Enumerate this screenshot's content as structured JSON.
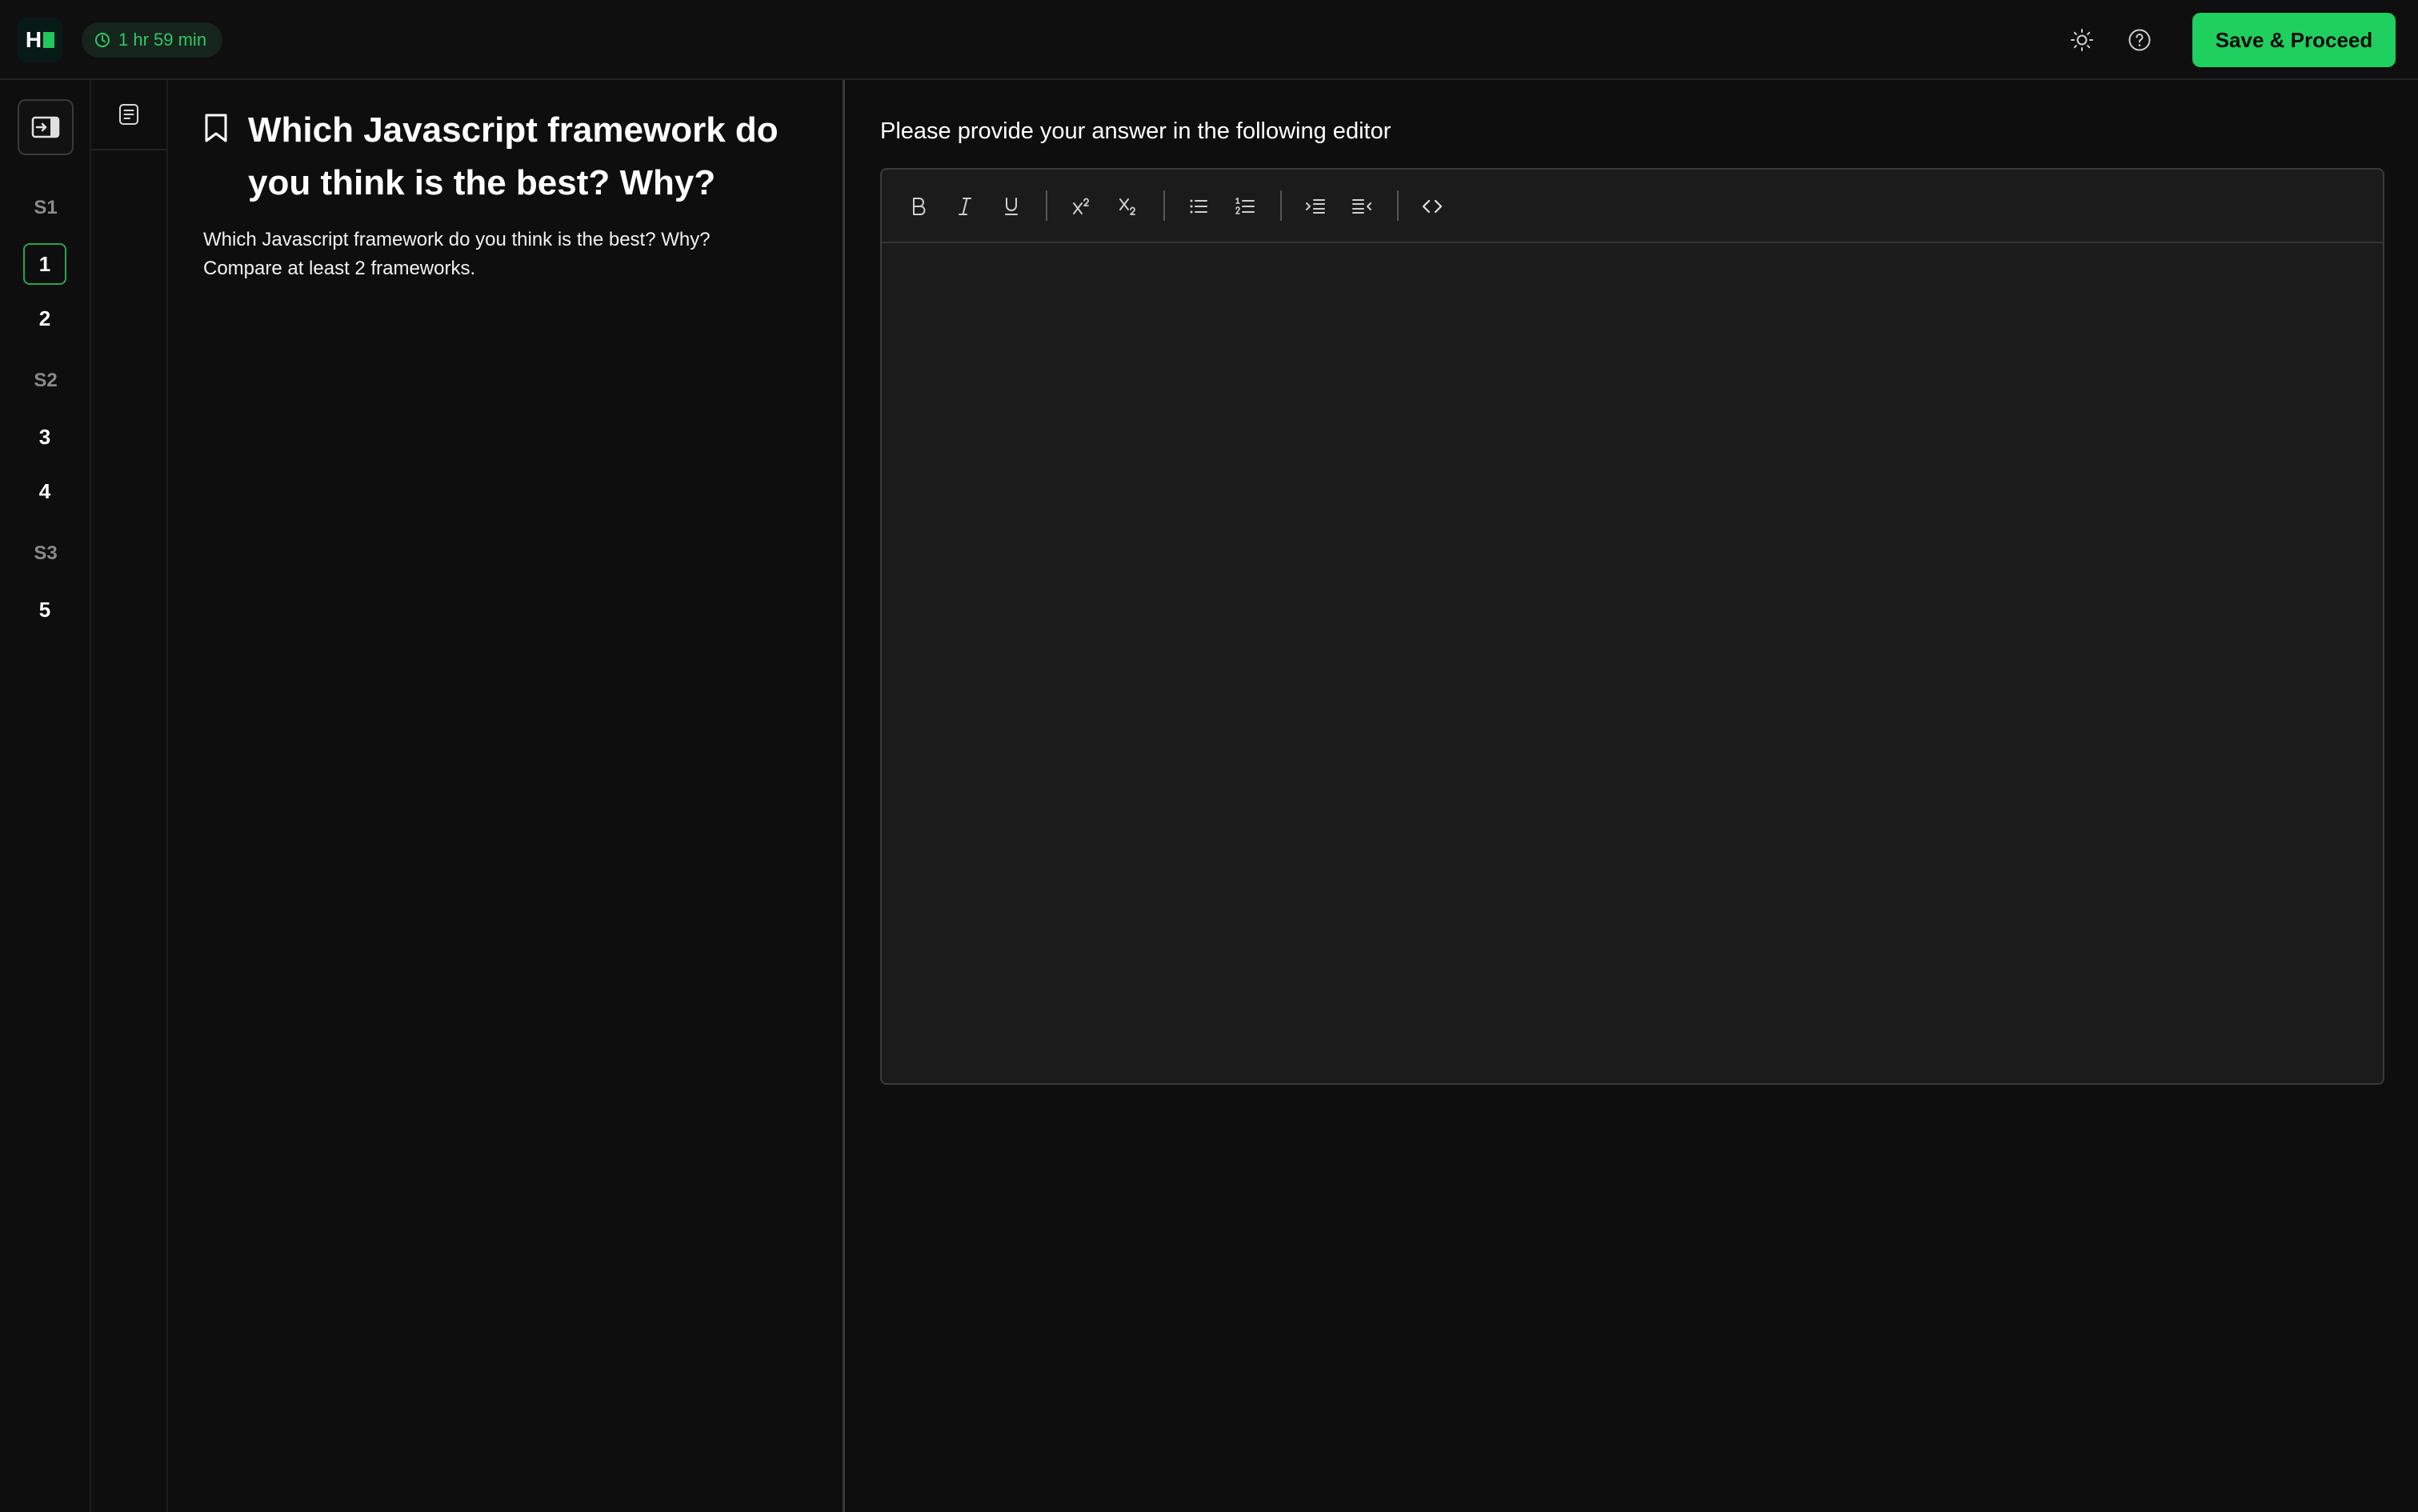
{
  "header": {
    "logo_text": "H",
    "timer": "1 hr 59 min",
    "save_label": "Save & Proceed",
    "icons": [
      "sun-icon",
      "help-icon"
    ]
  },
  "sidebar": {
    "sections": [
      {
        "label": "S1",
        "questions": [
          "1",
          "2"
        ]
      },
      {
        "label": "S2",
        "questions": [
          "3",
          "4"
        ]
      },
      {
        "label": "S3",
        "questions": [
          "5"
        ]
      }
    ],
    "active_question": "1"
  },
  "question": {
    "title": "Which Javascript framework do you think is the best? Why?",
    "body_line1": "Which Javascript framework do you think is the best?  Why?",
    "body_line2": "Compare at least 2 frameworks."
  },
  "answer": {
    "prompt": "Please provide your answer in the following editor",
    "toolbar": [
      "bold",
      "italic",
      "underline",
      "superscript",
      "subscript",
      "bullet-list",
      "numbered-list",
      "indent",
      "outdent",
      "code"
    ],
    "content": ""
  },
  "colors": {
    "accent": "#1fd05e",
    "background": "#0e0e0e",
    "editor_bg": "#1b1b1b"
  }
}
